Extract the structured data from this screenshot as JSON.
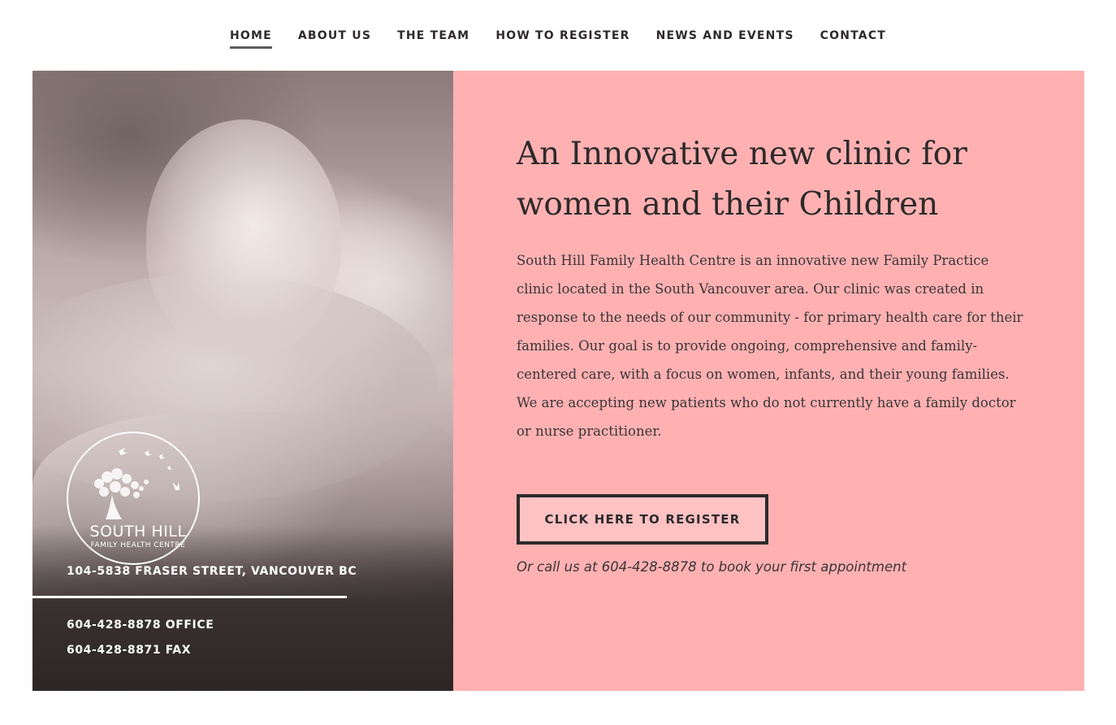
{
  "nav": {
    "items": [
      {
        "label": "HOME",
        "active": true
      },
      {
        "label": "ABOUT US"
      },
      {
        "label": "THE TEAM"
      },
      {
        "label": "HOW TO REGISTER"
      },
      {
        "label": "NEWS AND EVENTS"
      },
      {
        "label": "CONTACT"
      }
    ]
  },
  "sidebar": {
    "logo": {
      "name": "SOUTH HILL",
      "subtitle": "FAMILY HEALTH CENTRE",
      "icon": "tree-and-birds-icon"
    },
    "address": "104-5838 FRASER STREET, VANCOUVER BC",
    "phone_office": "604-428-8878 OFFICE",
    "phone_fax": "604-428-8871 FAX",
    "photo": "child-resting-photo"
  },
  "main": {
    "headline": "An Innovative new clinic for women and their Children",
    "intro": "South Hill Family Health Centre is an innovative new Family Practice clinic located in the South Vancouver area. Our clinic was created in response to the needs of our community - for primary health care for their families. Our goal is to provide ongoing, comprehensive and family-centered care, with a focus on women, infants, and their young families. We are accepting new patients who do not currently have a family doctor or nurse practitioner.",
    "register_button": "CLICK HERE TO REGISTER",
    "call_note": "Or call us at 604-428-8878 to book your first appointment"
  },
  "colors": {
    "panel_background": "#ffb1b2",
    "text_dark": "#2e2a2b",
    "button_background": "#ffc2c3"
  }
}
